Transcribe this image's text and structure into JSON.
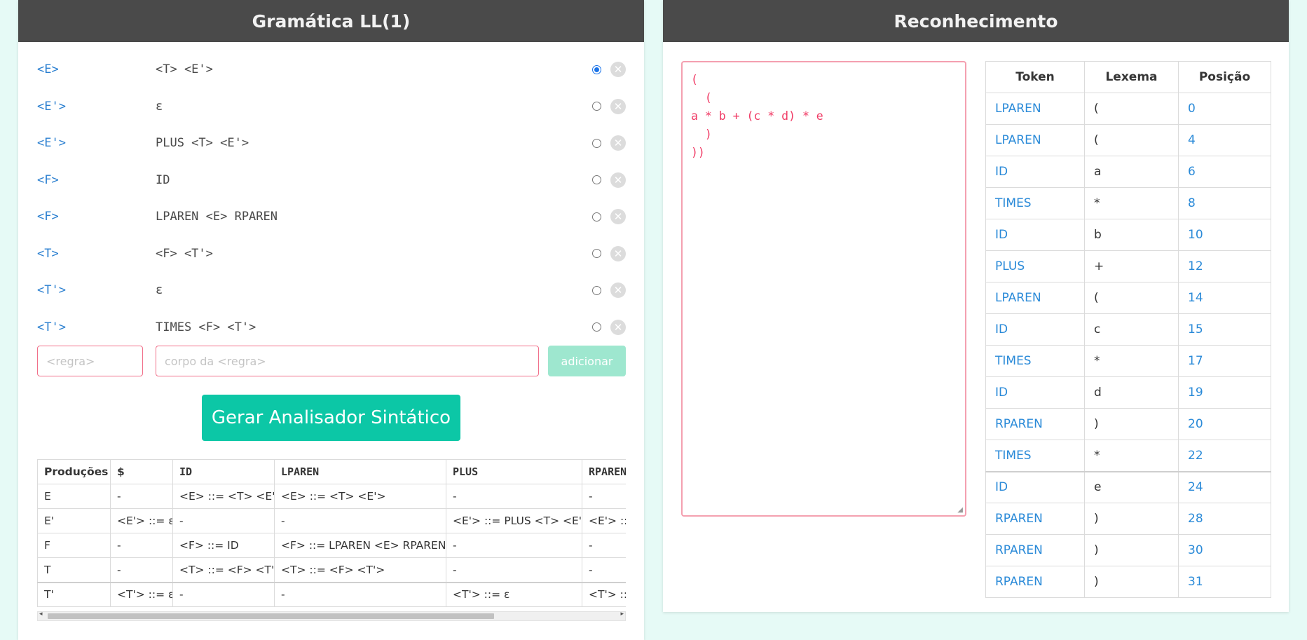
{
  "left_panel": {
    "title": "Gramática LL(1)"
  },
  "right_panel": {
    "title": "Reconhecimento"
  },
  "rules": [
    {
      "head": "<E>",
      "body": "<T> <E'>",
      "selected": true
    },
    {
      "head": "<E'>",
      "body": "ε",
      "selected": false
    },
    {
      "head": "<E'>",
      "body": "PLUS <T> <E'>",
      "selected": false
    },
    {
      "head": "<F>",
      "body": "ID",
      "selected": false
    },
    {
      "head": "<F>",
      "body": "LPAREN <E> RPAREN",
      "selected": false
    },
    {
      "head": "<T>",
      "body": "<F> <T'>",
      "selected": false
    },
    {
      "head": "<T'>",
      "body": "ε",
      "selected": false
    },
    {
      "head": "<T'>",
      "body": "TIMES <F> <T'>",
      "selected": false
    }
  ],
  "new_rule": {
    "name_placeholder": "<regra>",
    "body_placeholder": "corpo da <regra>",
    "add_label": "adicionar"
  },
  "generate_label": "Gerar Analisador Sintático",
  "parse_table": {
    "headers": [
      "Produções",
      "$",
      "ID",
      "LPAREN",
      "PLUS",
      "RPAREN"
    ],
    "rows": [
      [
        "E",
        "-",
        "<E> ::= <T> <E'>",
        "<E> ::= <T> <E'>",
        "-",
        "-"
      ],
      [
        "E'",
        "<E'> ::= ε",
        "-",
        "-",
        "<E'> ::= PLUS <T> <E'>",
        "<E'> ::= ε"
      ],
      [
        "F",
        "-",
        "<F> ::= ID",
        "<F> ::= LPAREN <E> RPAREN",
        "-",
        "-"
      ],
      [
        "T",
        "-",
        "<T> ::= <F> <T'>",
        "<T> ::= <F> <T'>",
        "-",
        "-"
      ],
      [
        "T'",
        "<T'> ::= ε",
        "-",
        "-",
        "<T'> ::= ε",
        "<T'> ::= ε"
      ]
    ]
  },
  "input_text": "(\n  (\na * b + (c * d) * e\n  )\n))",
  "token_table": {
    "headers": [
      "Token",
      "Lexema",
      "Posição"
    ],
    "rows": [
      [
        "LPAREN",
        "(",
        "0"
      ],
      [
        "LPAREN",
        "(",
        "4"
      ],
      [
        "ID",
        "a",
        "6"
      ],
      [
        "TIMES",
        "*",
        "8"
      ],
      [
        "ID",
        "b",
        "10"
      ],
      [
        "PLUS",
        "+",
        "12"
      ],
      [
        "LPAREN",
        "(",
        "14"
      ],
      [
        "ID",
        "c",
        "15"
      ],
      [
        "TIMES",
        "*",
        "17"
      ],
      [
        "ID",
        "d",
        "19"
      ],
      [
        "RPAREN",
        ")",
        "20"
      ],
      [
        "TIMES",
        "*",
        "22"
      ],
      [
        "ID",
        "e",
        "24"
      ],
      [
        "RPAREN",
        ")",
        "28"
      ],
      [
        "RPAREN",
        ")",
        "30"
      ],
      [
        "RPAREN",
        ")",
        "31"
      ]
    ]
  }
}
